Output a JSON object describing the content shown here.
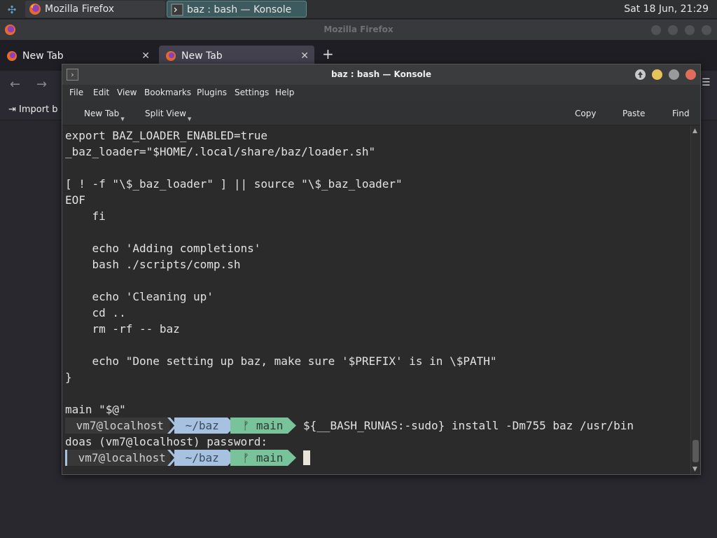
{
  "taskbar": {
    "tasks": [
      {
        "label": "Mozilla Firefox"
      },
      {
        "label": "baz : bash — Konsole"
      }
    ],
    "clock": "Sat 18 Jun, 21:29"
  },
  "firefox": {
    "title": "Mozilla Firefox",
    "tabs": [
      {
        "label": "New Tab"
      },
      {
        "label": "New Tab"
      }
    ],
    "import_bookmarks": "Import b"
  },
  "konsole": {
    "title": "baz : bash — Konsole",
    "menu": [
      "File",
      "Edit",
      "View",
      "Bookmarks",
      "Plugins",
      "Settings",
      "Help"
    ],
    "toolbar": {
      "new_tab": "New Tab",
      "split_view": "Split View",
      "copy": "Copy",
      "paste": "Paste",
      "find": "Find"
    },
    "terminal_lines": [
      "export BAZ_LOADER_ENABLED=true",
      "_baz_loader=\"$HOME/.local/share/baz/loader.sh\"",
      "",
      "[ ! -f \"\\$_baz_loader\" ] || source \"\\$_baz_loader\"",
      "EOF",
      "    fi",
      "",
      "    echo 'Adding completions'",
      "    bash ./scripts/comp.sh",
      "",
      "    echo 'Cleaning up'",
      "    cd ..",
      "    rm -rf -- baz",
      "",
      "    echo \"Done setting up baz, make sure '$PREFIX' is in \\$PATH\"",
      "}",
      "",
      "main \"$@\""
    ],
    "prompt1": {
      "user": " vm7@localhost ",
      "path": " ~/baz ",
      "git": " ᚠ main ",
      "command": "${__BASH_RUNAS:-sudo} install -Dm755 baz /usr/bin"
    },
    "password_prompt": "doas (vm7@localhost) password:",
    "prompt2": {
      "user": " vm7@localhost ",
      "path": " ~/baz ",
      "git": " ᚠ main "
    }
  },
  "colors": {
    "path_segment": "#a7c2e0",
    "git_segment": "#79c39a",
    "user_segment": "#383838",
    "close_button": "#e06c5a",
    "minimize_button": "#e7c35a"
  }
}
